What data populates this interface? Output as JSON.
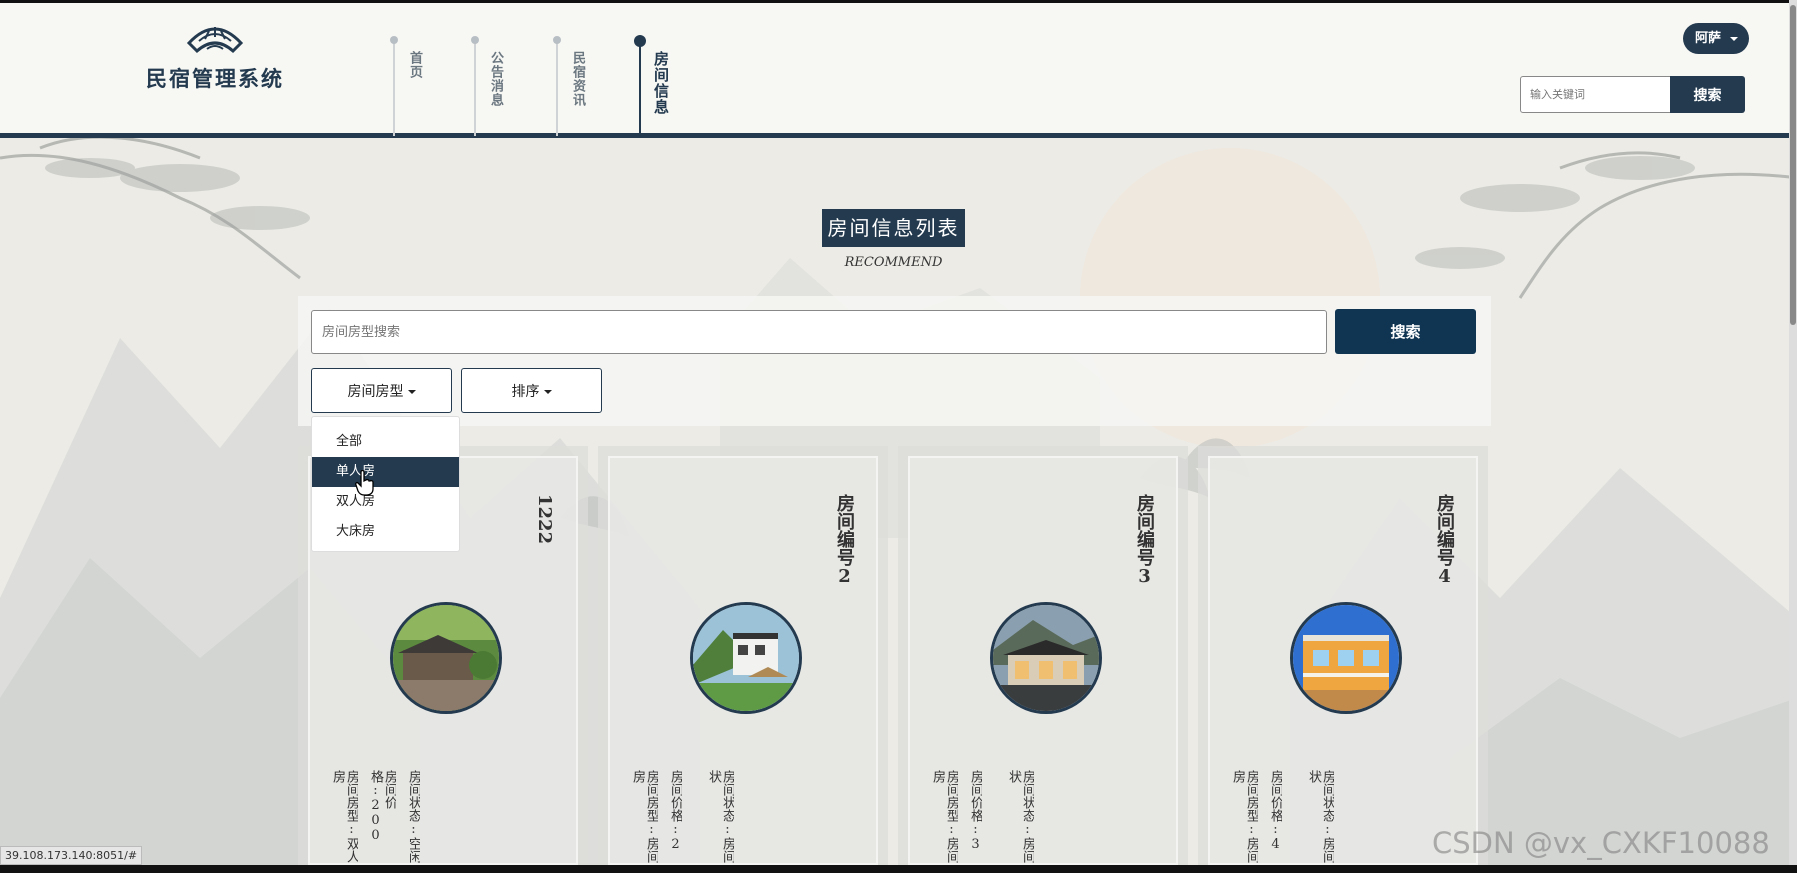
{
  "app": {
    "title": "民宿管理系统"
  },
  "nav": [
    {
      "label": "首页",
      "active": false
    },
    {
      "label": "公告消息",
      "active": false
    },
    {
      "label": "民宿资讯",
      "active": false
    },
    {
      "label": "房间信息",
      "active": true
    }
  ],
  "user": {
    "name": "阿萨"
  },
  "header_search": {
    "placeholder": "输入关键词",
    "button": "搜索"
  },
  "page": {
    "title": "房间信息列表",
    "subtitle": "RECOMMEND"
  },
  "search": {
    "placeholder": "房间房型搜索",
    "button": "搜索"
  },
  "filters": {
    "room_type_label": "房间房型",
    "sort_label": "排序",
    "menu_items": [
      "全部",
      "单人房",
      "双人房",
      "大床房"
    ],
    "selected": "单人房"
  },
  "cards": [
    {
      "room_no": "1222",
      "type_line": "房间房型:双人房",
      "price_line": "房间价格:200",
      "status_line": "房间状态:空闲"
    },
    {
      "room_no": "房间编号2",
      "type_line": "房间房型:房间房",
      "price_line": "房间价格:2",
      "status_line": "房间状态:房间状"
    },
    {
      "room_no": "房间编号3",
      "type_line": "房间房型:房间房",
      "price_line": "房间价格:3",
      "status_line": "房间状态:房间状"
    },
    {
      "room_no": "房间编号4",
      "type_line": "房间房型:房间房",
      "price_line": "房间价格:4",
      "status_line": "房间状态:房间状"
    }
  ],
  "status_url": "39.108.173.140:8051/#",
  "watermark": "CSDN @vx_CXKF10088",
  "colors": {
    "primary": "#233a4f",
    "button": "#0f3553",
    "background": "#ecebe6"
  }
}
